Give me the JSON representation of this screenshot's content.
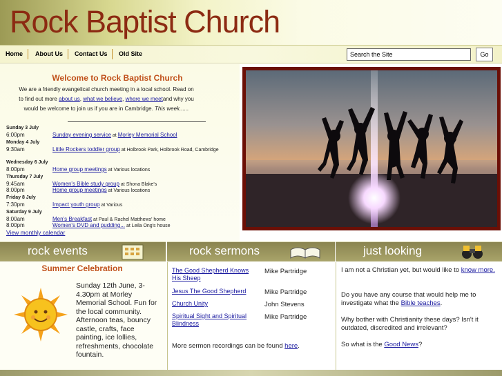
{
  "header": {
    "title": "Rock Baptist Church"
  },
  "nav": {
    "items": [
      "Home",
      "About Us",
      "Contact Us",
      "Old Site"
    ],
    "search_placeholder": "Search the Site",
    "go_label": "Go"
  },
  "intro": {
    "welcome": "Welcome to Rock Baptist Church",
    "line1": "We are a friendly evangelical church meeting in a local school. Read on",
    "line2_pre": "to find out more",
    "link_about": "about us",
    "link_believe": "what we believe",
    "link_meet": "where we meet",
    "line2_post": "and why you",
    "line3_pre": "would be welcome to join us if you are in Cambridge.",
    "line3_italic": "This week......"
  },
  "calendar": {
    "days": [
      {
        "day": "Sunday 3 July",
        "events": [
          {
            "time": "6:00pm",
            "title": "Sunday evening service",
            "at": " at ",
            "loc": "Morley Memorial School",
            "loc_link": true
          }
        ]
      },
      {
        "day": "Monday 4 July",
        "events": [
          {
            "time": "9:30am",
            "title": "Little Rockers toddler group",
            "at": " at ",
            "loc": "Holbrook Park, Holbrook Road, Cambridge",
            "loc_link": false
          }
        ]
      },
      {
        "day": "Wednesday 6 July",
        "events": [
          {
            "time": "8:00pm",
            "title": "Home group meetings",
            "at": " at ",
            "loc": "Various locations",
            "loc_link": false
          }
        ]
      },
      {
        "day": "Thursday 7 July",
        "events": [
          {
            "time": "9:45am",
            "title": "Women's Bible study group",
            "at": " at ",
            "loc": "Shona Blake's",
            "loc_link": false
          },
          {
            "time": "8:00pm",
            "title": "Home group meetings",
            "at": " at ",
            "loc": "Various locations",
            "loc_link": false
          }
        ]
      },
      {
        "day": "Friday 8 July",
        "events": [
          {
            "time": "7:30pm",
            "title": "Impact youth group",
            "at": " at ",
            "loc": "Various",
            "loc_link": false
          }
        ]
      },
      {
        "day": "Saturday 9 July",
        "events": [
          {
            "time": "8:00am",
            "title": "Men's Breakfast",
            "at": " at ",
            "loc": "Paul & Rachel Matthews' home",
            "loc_link": false
          },
          {
            "time": "8:00pm",
            "title": "Women's DVD and pudding...",
            "at": " at ",
            "loc": "Leila Ong's house",
            "loc_link": false
          }
        ]
      }
    ],
    "view_monthly": "View monthly calendar"
  },
  "sections": {
    "events": {
      "heading": "rock events",
      "title": "Summer Celebration",
      "text": "Sunday 12th June, 3-4.30pm at Morley Memorial School.  Fun for the local community. Afternoon teas, bouncy castle, crafts, face painting, ice lollies, refreshments, chocolate fountain."
    },
    "sermons": {
      "heading": "rock sermons",
      "items": [
        {
          "title": "The Good Shepherd Knows His Sheep",
          "speaker": "Mike Partridge"
        },
        {
          "title": "Jesus The Good Shepherd",
          "speaker": "Mike Partridge"
        },
        {
          "title": "Church Unity",
          "speaker": "John Stevens"
        },
        {
          "title": "Spiritual Sight and Spiritual Blindness",
          "speaker": "Mike Partridge"
        }
      ],
      "more_pre": "More sermon recordings can be found",
      "more_link": "here",
      "more_post": "."
    },
    "looking": {
      "heading": "just looking",
      "p1_pre": "I am not a Christian yet, but would like to",
      "p1_link": "know more.",
      "p2_pre": "Do you have any course that would help me to investigate what the",
      "p2_link": "Bible teaches",
      "p2_post": ".",
      "p3": "Why bother with Christianity these days? Isn't it outdated, discredited and irrelevant?",
      "p4_pre": "So what is the",
      "p4_link": "Good News",
      "p4_post": "?"
    }
  }
}
